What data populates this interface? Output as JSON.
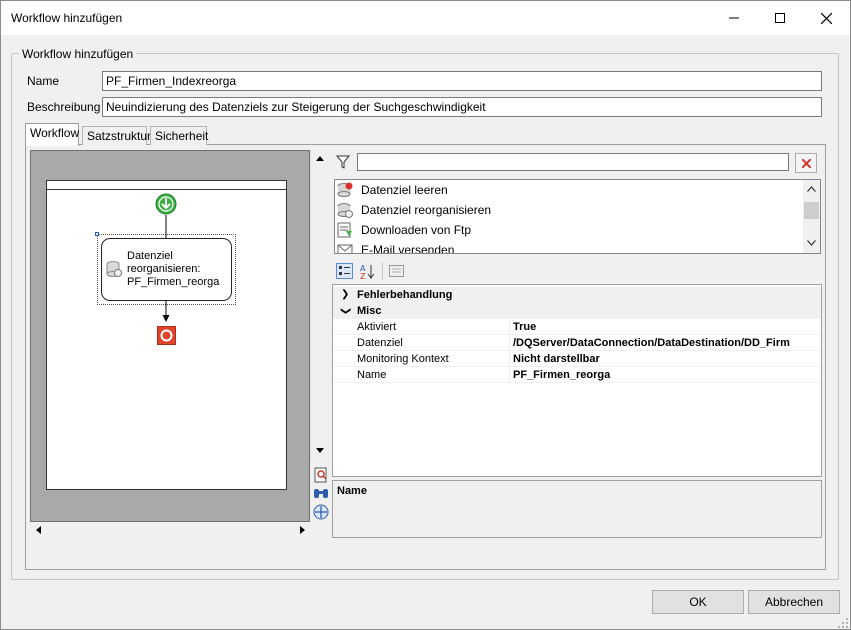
{
  "window": {
    "title": "Workflow hinzufügen",
    "controls": [
      "minimize-icon",
      "maximize-icon",
      "close-icon"
    ]
  },
  "group": {
    "title": "Workflow hinzufügen"
  },
  "form": {
    "name_label": "Name",
    "name_value": "PF_Firmen_Indexreorga",
    "description_label": "Beschreibung",
    "description_value": "Neuindizierung des Datenziels zur Steigerung der Suchgeschwindigkeit"
  },
  "tabs": [
    {
      "label": "Workflow",
      "active": true
    },
    {
      "label": "Satzstruktur",
      "active": false
    },
    {
      "label": "Sicherheit",
      "active": false
    }
  ],
  "canvas": {
    "node_label_lines": [
      "Datenziel",
      "reorganisieren:",
      "PF_Firmen_reorga"
    ]
  },
  "activities": {
    "filter_value": "",
    "items": [
      {
        "label": "Datenziel leeren",
        "icon": "clear-database-icon"
      },
      {
        "label": "Datenziel reorganisieren",
        "icon": "reorganize-database-icon"
      },
      {
        "label": "Downloaden von Ftp",
        "icon": "ftp-download-icon"
      },
      {
        "label": "E-Mail versenden",
        "icon": "email-icon"
      }
    ]
  },
  "properties": {
    "categories": [
      {
        "label": "Fehlerbehandlung",
        "expanded": false
      },
      {
        "label": "Misc",
        "expanded": true
      }
    ],
    "rows": [
      {
        "name": "Aktiviert",
        "value": "True"
      },
      {
        "name": "Datenziel",
        "value": "/DQServer/DataConnection/DataDestination/DD_Firm"
      },
      {
        "name": "Monitoring Kontext",
        "value": "Nicht darstellbar"
      },
      {
        "name": "Name",
        "value": "PF_Firmen_reorga"
      }
    ],
    "description_title": "Name"
  },
  "buttons": {
    "ok": "OK",
    "cancel": "Abbrechen"
  },
  "colors": {
    "start_node": "#3cb043",
    "end_node": "#e0452c",
    "delete_filter": "#d9342b"
  }
}
